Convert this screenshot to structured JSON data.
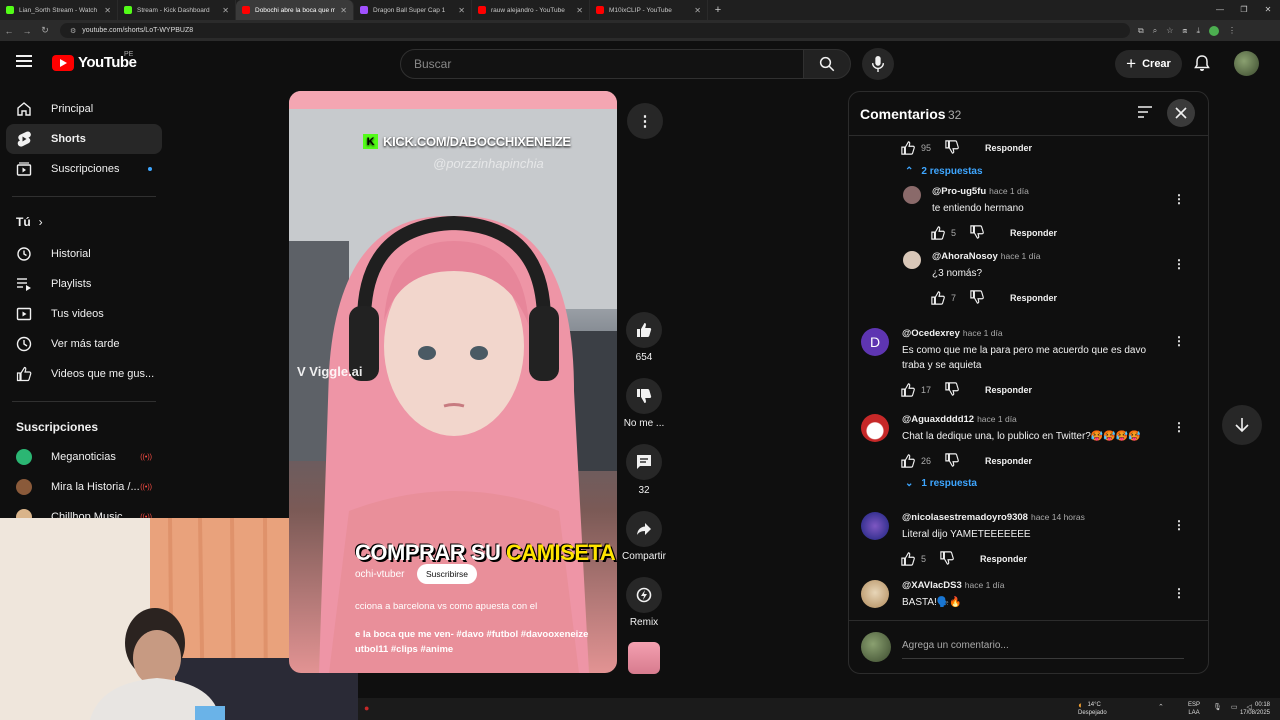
{
  "browser": {
    "tabs": [
      {
        "title": "Lian_Sorth Stream - Watch Live",
        "color": "#53fc18"
      },
      {
        "title": "Stream - Kick Dashboard",
        "color": "#53fc18"
      },
      {
        "title": "Dobochi abre la boca que m",
        "color": "#ff0000"
      },
      {
        "title": "Dragon Ball Super Cap 1",
        "color": "#a050ff"
      },
      {
        "title": "rauw alejandro - YouTube",
        "color": "#ff0000"
      },
      {
        "title": "M10ixCLIP - YouTube",
        "color": "#ff0000"
      }
    ],
    "url": "youtube.com/shorts/LoT-WYPBUZ8"
  },
  "header": {
    "logo_text": "YouTube",
    "country": "PE",
    "search_placeholder": "Buscar",
    "create_label": "Crear"
  },
  "sidebar": {
    "main": [
      {
        "label": "Principal",
        "icon": "home-icon"
      },
      {
        "label": "Shorts",
        "icon": "shorts-icon",
        "active": true
      },
      {
        "label": "Suscripciones",
        "icon": "subscriptions-icon",
        "dot": true
      }
    ],
    "you_title": "Tú",
    "you": [
      {
        "label": "Historial",
        "icon": "history-icon"
      },
      {
        "label": "Playlists",
        "icon": "playlists-icon"
      },
      {
        "label": "Tus videos",
        "icon": "your-videos-icon"
      },
      {
        "label": "Ver más tarde",
        "icon": "watch-later-icon"
      },
      {
        "label": "Videos que me gus...",
        "icon": "liked-icon"
      }
    ],
    "subs_title": "Suscripciones",
    "subs": [
      {
        "label": "Meganoticias",
        "color": "#2bb673"
      },
      {
        "label": "Mira la Historia /...",
        "color": "#8a5a3a"
      },
      {
        "label": "Chillhop Music",
        "color": "#d9b48a"
      }
    ]
  },
  "video": {
    "kick_text": "KICK.COM/DABOCCHIXENEIZE",
    "watermark": "@porzzinhapinchia",
    "viggle": "Viggle.ai",
    "caption_white": "COMPRAR SU ",
    "caption_yellow": "CAMISETA",
    "channel": "ochi-vtuber",
    "subscribe_label": "Suscribirse",
    "description": "cciona a barcelona vs como apuesta con el",
    "tags_line1": "e la boca que me ven-  #davo #futbol #davooxeneize",
    "tags_line2": "utbol11 #clips #anime"
  },
  "actions": {
    "likes": "654",
    "dislike_label": "No me ...",
    "comments": "32",
    "share_label": "Compartir",
    "remix_label": "Remix"
  },
  "comments": {
    "title": "Comentarios",
    "count": "32",
    "reply_label": "Responder",
    "add_placeholder": "Agrega un comentario...",
    "top_likes": "95",
    "top_replies": "2 respuestas",
    "items": [
      {
        "author": "@Pro-ug5fu",
        "time": "hace 1 día",
        "text": "te entiendo hermano",
        "likes": "5"
      },
      {
        "author": "@AhoraNosoy",
        "time": "hace 1 día",
        "text": "¿3 nomás?",
        "likes": "7"
      },
      {
        "author": "@Ocedexrey",
        "time": "hace 1 día",
        "text": "Es como que me la para pero me acuerdo que es davo",
        "text2": "traba y se aquieta",
        "likes": "17",
        "initial": "D"
      },
      {
        "author": "@Aguaxdddd12",
        "time": "hace 1 día",
        "text": "Chat la dedique una, lo publico en Twitter?🥵🥵🥵🥵",
        "likes": "26"
      },
      {
        "author": "@nicolasestremadoyro9308",
        "time": "hace 14 horas",
        "text": "Literal dijo YAMETEEEEEEE",
        "likes": "5"
      },
      {
        "author": "@XAVIacDS3",
        "time": "hace 1 día",
        "text": "BASTA!🗣️🔥"
      }
    ],
    "one_reply": "1 respuesta"
  },
  "taskbar": {
    "temp": "14°C",
    "weather": "Despejado",
    "lang1": "ESP",
    "lang2": "LAA",
    "time": "00:18",
    "date": "17/08/2025"
  },
  "colors": {
    "accent_blue": "#3ea6ff",
    "yt_red": "#ff0000",
    "kick_green": "#53fc18",
    "caption_yellow": "#ffe400"
  }
}
